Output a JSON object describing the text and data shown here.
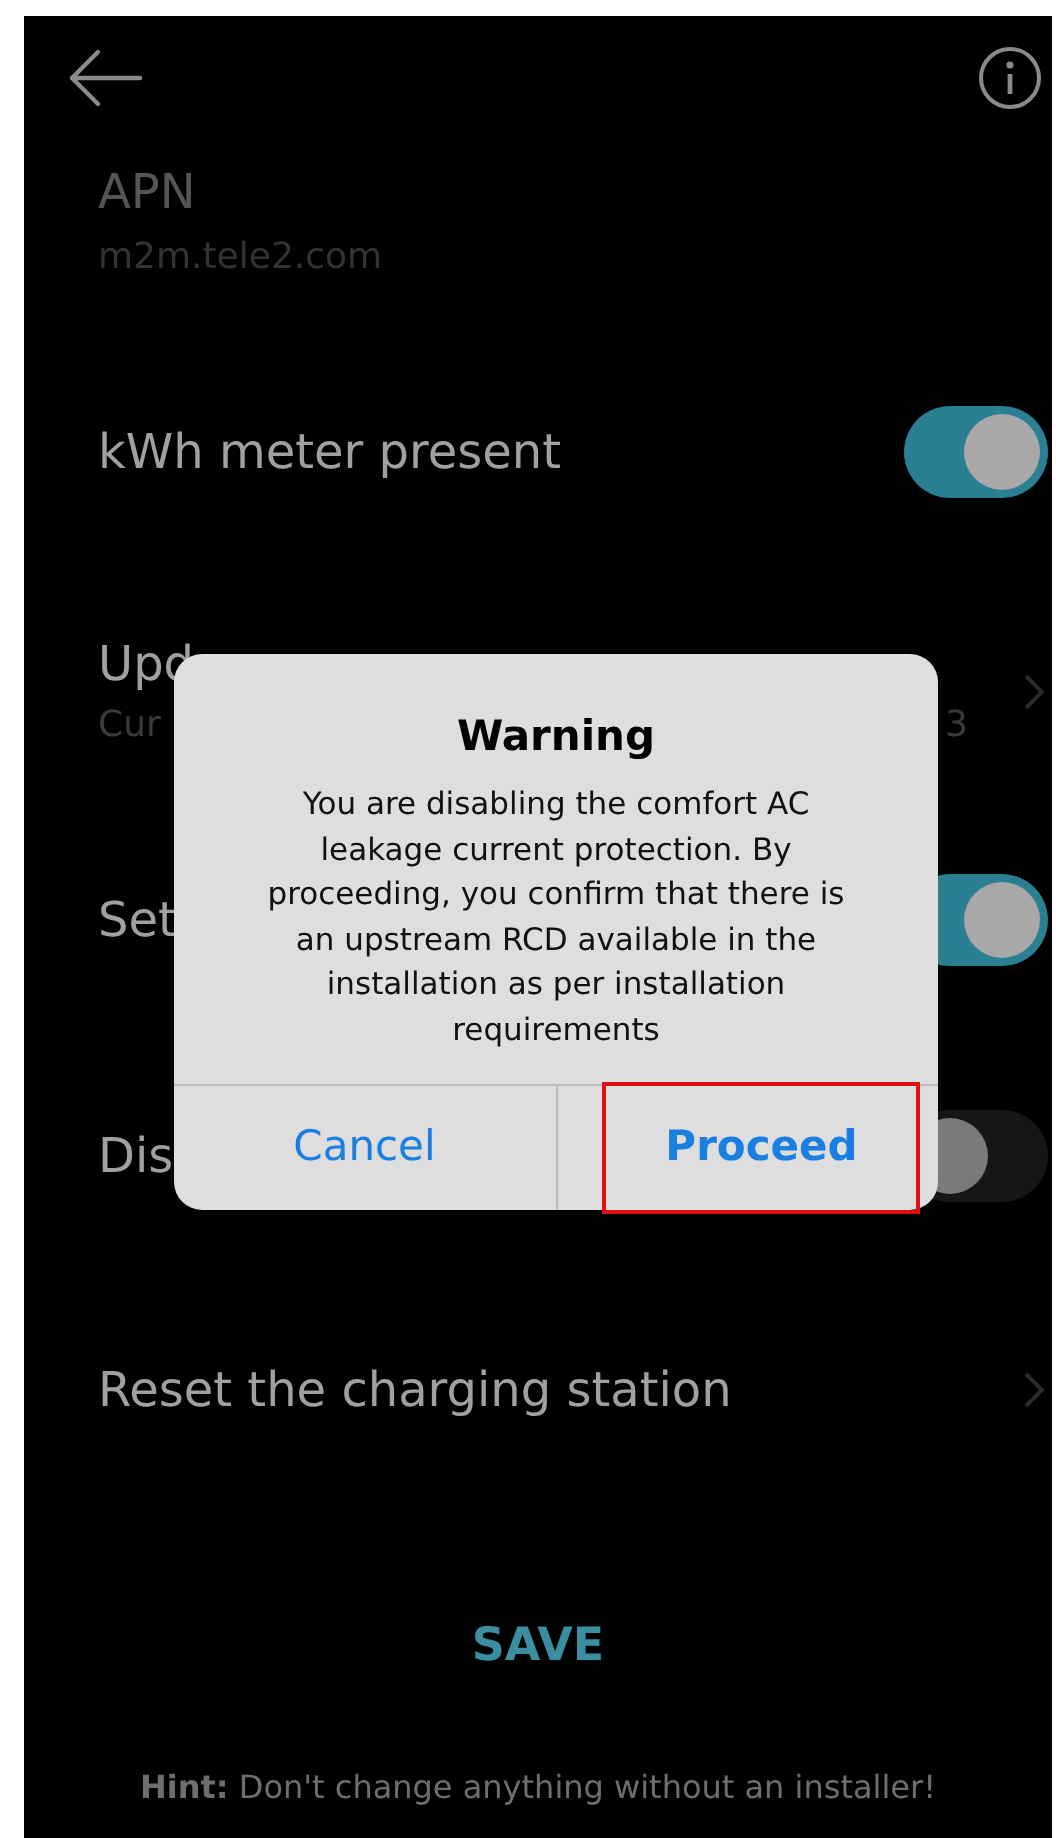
{
  "settings": [
    {
      "kind": "value",
      "title": "APN",
      "value": "m2m.tele2.com"
    },
    {
      "kind": "toggle",
      "title": "kWh meter present",
      "on": true
    },
    {
      "kind": "link",
      "title": "Upd",
      "subtitle": "Cur",
      "subtitle_tail": "3"
    },
    {
      "kind": "toggle",
      "title": "Set",
      "on": true
    },
    {
      "kind": "toggle",
      "title": "Dis",
      "on": false
    },
    {
      "kind": "link",
      "title": "Reset the charging station"
    }
  ],
  "save_button": "SAVE",
  "hint": "**Hint:** Don't change anything without an installer!",
  "dialog": {
    "title": "Warning",
    "message": "You are disabling the comfort AC leakage current protection. By proceeding, you confirm that there is an upstream RCD available in the installation as per installation requirements",
    "buttons": [
      {
        "label": "Cancel",
        "primary": false,
        "highlighted": false
      },
      {
        "label": "Proceed",
        "primary": true,
        "highlighted": true
      }
    ]
  }
}
